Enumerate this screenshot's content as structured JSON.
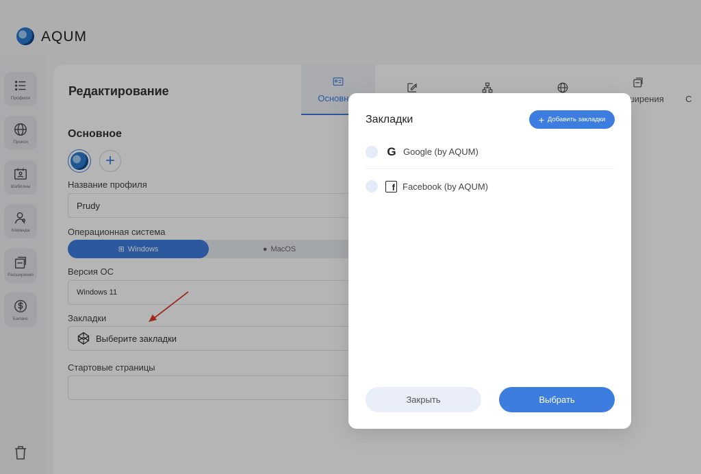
{
  "app": {
    "brand": "AQUM"
  },
  "sidebar": {
    "items": [
      {
        "label": "Профили",
        "icon": "list-icon"
      },
      {
        "label": "Прокси",
        "icon": "globe-icon"
      },
      {
        "label": "Шаблоны",
        "icon": "template-icon"
      },
      {
        "label": "Команда",
        "icon": "team-icon"
      },
      {
        "label": "Расширения",
        "icon": "extensions-icon"
      },
      {
        "label": "Баланс",
        "icon": "dollar-icon"
      }
    ]
  },
  "main": {
    "title": "Редактирование",
    "tabs": [
      {
        "label": "Основное",
        "icon": "id-card-icon",
        "active": true
      },
      {
        "label": "",
        "icon": "edit-icon"
      },
      {
        "label": "",
        "icon": "network-icon"
      },
      {
        "label": "",
        "icon": "globe-icon"
      },
      {
        "label": "Расширения",
        "icon": "extensions-icon"
      },
      {
        "label": "С",
        "icon": ""
      }
    ],
    "section_title": "Основное",
    "profile_name_label": "Название профиля",
    "profile_name_value": "Prudy",
    "os_label": "Операционная система",
    "os_options": [
      "Windows",
      "MacOS"
    ],
    "os_selected": "Windows",
    "os_version_label": "Версия ОС",
    "os_version_value": "Windows 11",
    "bookmarks_label": "Закладки",
    "bookmarks_placeholder": "Выберите закладки",
    "start_pages_label": "Стартовые страницы"
  },
  "modal": {
    "title": "Закладки",
    "add_button": "Добавить закладки",
    "items": [
      {
        "label": "Google (by AQUM)",
        "icon": "google-icon"
      },
      {
        "label": "Facebook (by AQUM)",
        "icon": "facebook-icon"
      }
    ],
    "close_button": "Закрыть",
    "select_button": "Выбрать"
  },
  "colors": {
    "accent": "#3d7de0",
    "arrow": "#e03a2e"
  }
}
